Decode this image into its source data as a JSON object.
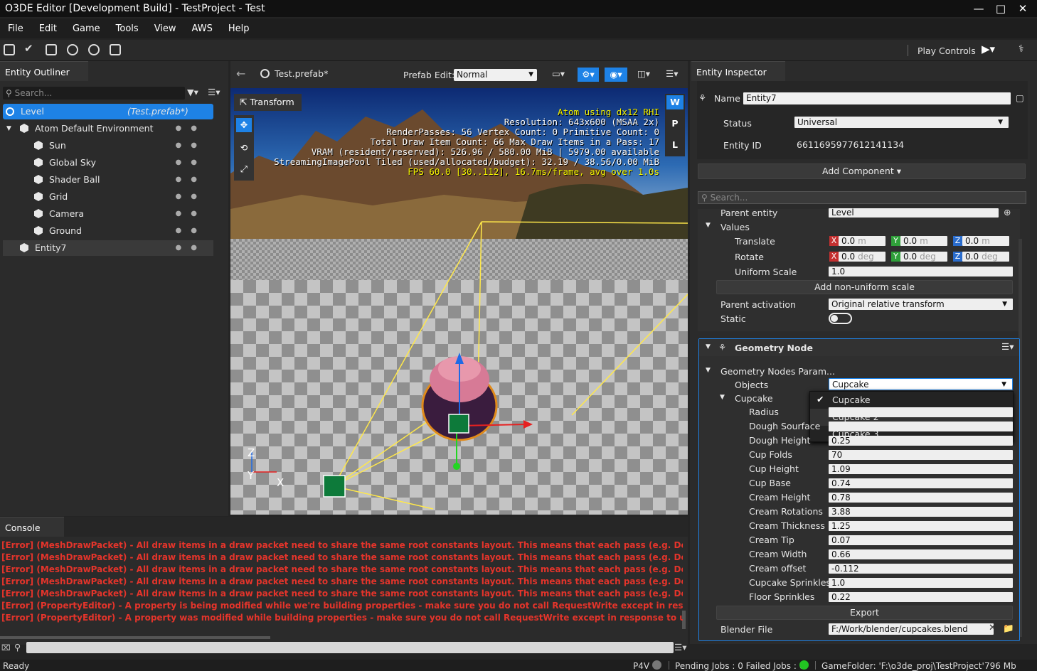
{
  "window": {
    "title": "O3DE Editor [Development Build] - TestProject - Test"
  },
  "menu": [
    "File",
    "Edit",
    "Game",
    "Tools",
    "View",
    "AWS",
    "Help"
  ],
  "toolbar": {
    "play_controls": "Play Controls"
  },
  "outliner": {
    "tab": "Entity Outliner",
    "search_placeholder": "Search...",
    "level": {
      "label": "Level",
      "prefab": "(Test.prefab*)"
    },
    "items": [
      {
        "label": "Atom Default Environment",
        "depth": 1
      },
      {
        "label": "Sun",
        "depth": 2
      },
      {
        "label": "Global Sky",
        "depth": 2
      },
      {
        "label": "Shader Ball",
        "depth": 2
      },
      {
        "label": "Grid",
        "depth": 2
      },
      {
        "label": "Camera",
        "depth": 2
      },
      {
        "label": "Ground",
        "depth": 2
      },
      {
        "label": "Entity7",
        "depth": 1
      }
    ]
  },
  "viewport": {
    "tab": "Test.prefab*",
    "prefab_edit_label": "Prefab Edit:",
    "prefab_edit_value": "Normal",
    "transform_label": "Transform",
    "side_buttons": [
      "W",
      "P",
      "L"
    ],
    "axis": {
      "z": "Z",
      "y": "Y",
      "x": "X"
    },
    "info": [
      "Atom using dx12 RHI",
      "Resolution: 643x600 (MSAA 2x)",
      "RenderPasses: 56 Vertex Count: 0 Primitive Count: 0",
      "Total Draw Item Count: 66  Max Draw Items in a Pass: 17",
      "VRAM (resident/reserved): 526.96 / 580.00 MiB | 5979.00 available",
      "StreamingImagePool Tiled (used/allocated/budget): 32.19 / 38.56/0.00 MiB",
      "FPS 60.0 [30..112], 16.7ms/frame, avg over 1.0s"
    ]
  },
  "inspector": {
    "tab": "Entity Inspector",
    "name_label": "Name",
    "name_value": "Entity7",
    "status_label": "Status",
    "status_value": "Universal",
    "entity_id_label": "Entity ID",
    "entity_id_value": "6611695977612141134",
    "add_component": "Add Component",
    "search_placeholder": "Search...",
    "parent_entity_label": "Parent entity",
    "parent_entity_value": "Level",
    "values_label": "Values",
    "translate_label": "Translate",
    "rotate_label": "Rotate",
    "uniform_scale_label": "Uniform Scale",
    "uniform_scale_value": "1.0",
    "translate": [
      "0.0",
      "0.0",
      "0.0"
    ],
    "translate_unit": "m",
    "rotate": [
      "0.0",
      "0.0",
      "0.0"
    ],
    "rotate_unit": "deg",
    "add_nonuniform": "Add non-uniform scale",
    "parent_activation_label": "Parent activation",
    "parent_activation_value": "Original relative transform",
    "static_label": "Static",
    "geometry_node_title": "Geometry Node",
    "gn_params_label": "Geometry Nodes Param...",
    "objects_label": "Objects",
    "objects_value": "Cupcake",
    "cupcake_group": "Cupcake",
    "dropdown_options": [
      "Cupcake",
      "Cupcake 2",
      "Cupcake 3"
    ],
    "params": [
      {
        "label": "Radius",
        "value": ""
      },
      {
        "label": "Dough Sourface",
        "value": ""
      },
      {
        "label": "Dough Height",
        "value": "0.25"
      },
      {
        "label": "Cup Folds",
        "value": "70"
      },
      {
        "label": "Cup Height",
        "value": "1.09"
      },
      {
        "label": "Cup Base",
        "value": "0.74"
      },
      {
        "label": "Cream Height",
        "value": "0.78"
      },
      {
        "label": "Cream Rotations",
        "value": "3.88"
      },
      {
        "label": "Cream Thickness",
        "value": "1.25"
      },
      {
        "label": "Cream Tip",
        "value": "0.07"
      },
      {
        "label": "Cream Width",
        "value": "0.66"
      },
      {
        "label": "Cream offset",
        "value": "-0.112"
      },
      {
        "label": "Cupcake Sprinkles",
        "value": "1.0"
      },
      {
        "label": "Floor Sprinkles",
        "value": "0.22"
      }
    ],
    "export": "Export",
    "blender_file_label": "Blender File",
    "blender_file_value": "F:/Work/blender/cupcakes.blend"
  },
  "console": {
    "tab": "Console",
    "lines": [
      "[Error] (MeshDrawPacket) - All draw items in a draw packet need to share the same root constants layout. This means that each pass (e.g. Depth, Shadows, Forward",
      "[Error] (MeshDrawPacket) - All draw items in a draw packet need to share the same root constants layout. This means that each pass (e.g. Depth, Shadows, Forward",
      "[Error] (MeshDrawPacket) - All draw items in a draw packet need to share the same root constants layout. This means that each pass (e.g. Depth, Shadows, Forward",
      "[Error] (MeshDrawPacket) - All draw items in a draw packet need to share the same root constants layout. This means that each pass (e.g. Depth, Shadows, Forward",
      "[Error] (MeshDrawPacket) - All draw items in a draw packet need to share the same root constants layout. This means that each pass (e.g. Depth, Shadows, Forward",
      "[Error] (PropertyEditor) - A property is being modified while we're building properties - make sure you do not call RequestWrite except in response to user action.",
      "[Error] (PropertyEditor) - A property was modified while building properties - make sure you do not call RequestWrite except in response to user action. An undo w"
    ]
  },
  "status": {
    "ready": "Ready",
    "p4v": "P4V",
    "jobs": "Pending Jobs : 0  Failed Jobs : 0",
    "gamefolder": "GameFolder: 'F:\\o3de_proj\\TestProject'",
    "memory": "796 Mb"
  },
  "colors": {
    "accent": "#1e82e6",
    "error": "#e4342b",
    "selection": "#1e82e6"
  }
}
